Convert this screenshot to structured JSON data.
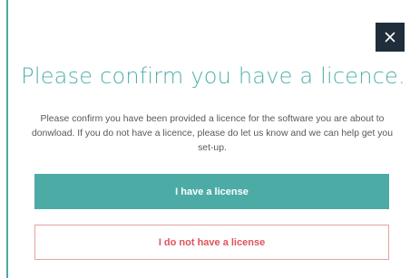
{
  "dialog": {
    "close_icon": "close-icon",
    "title": "Please confirm you have a licence.",
    "message": "Please confirm you have been provided a licence for the software you are about to donwload. If you do not have a licence, please do let us know and we can help get you set-up.",
    "confirm_button_label": "I have a license",
    "decline_button_label": "I do not have a license"
  },
  "colors": {
    "accent": "#4daba6",
    "close_button_bg": "#1f2e3a",
    "decline_text": "#e0525d",
    "decline_border": "#e7a1a1"
  }
}
